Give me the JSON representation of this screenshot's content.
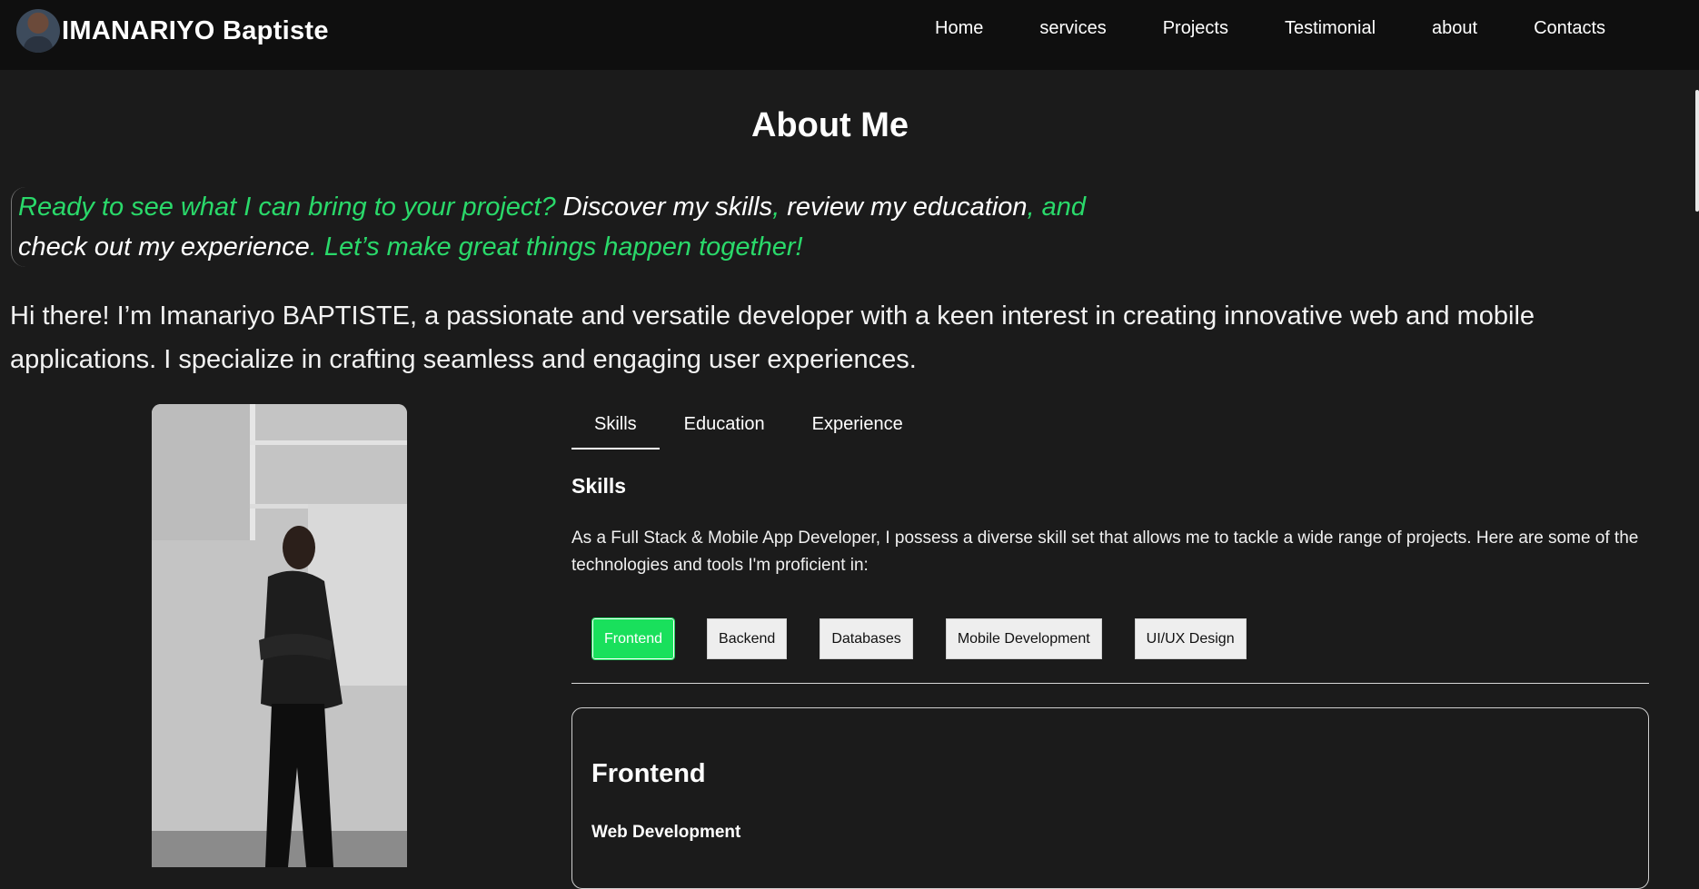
{
  "nav": {
    "brand": "IMANARIYO Baptiste",
    "links": [
      "Home",
      "services",
      "Projects",
      "Testimonial",
      "about",
      "Contacts"
    ]
  },
  "about": {
    "title": "About Me",
    "quote": {
      "p1": "Ready to see what I can bring to your project? ",
      "p2": "Discover my skills",
      "p3": ", ",
      "p4": "review my education",
      "p5": ", and ",
      "p6": "check out my experience",
      "p7": ". Let’s make great things happen together!"
    },
    "intro": "Hi there! I’m Imanariyo BAPTISTE, a passionate and versatile developer with a keen interest in creating innovative web and mobile applications. I specialize in crafting seamless and engaging user experiences."
  },
  "tabs": [
    "Skills",
    "Education",
    "Experience"
  ],
  "skills": {
    "heading": "Skills",
    "description": "As a Full Stack & Mobile App Developer, I possess a diverse skill set that allows me to tackle a wide range of projects. Here are some of the technologies and tools I'm proficient in:",
    "categories": [
      "Frontend",
      "Backend",
      "Databases",
      "Mobile Development",
      "UI/UX Design"
    ],
    "panel_title": "Frontend",
    "panel_subtitle": "Web Development"
  },
  "colors": {
    "accent": "#2ad96a",
    "background": "#1b1b1b",
    "navbar": "#0f0f0f"
  }
}
